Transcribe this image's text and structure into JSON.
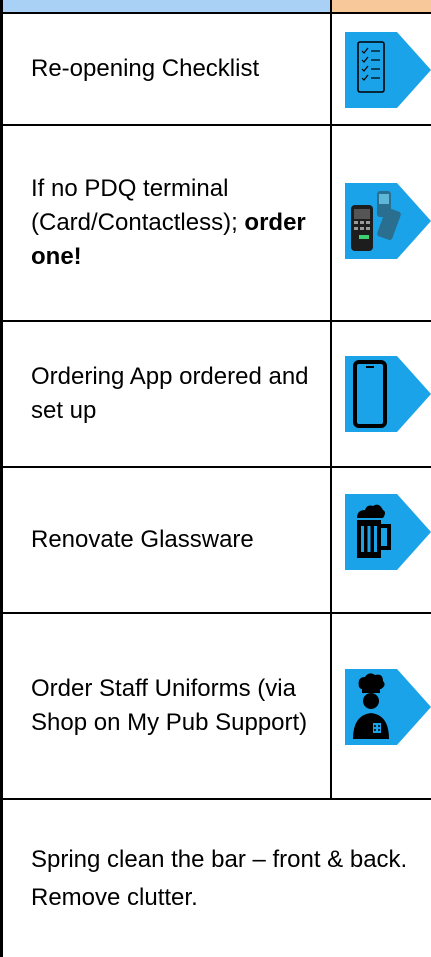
{
  "checklist": {
    "rows": [
      {
        "label": "Re-opening Checklist",
        "icon": "checklist-icon"
      },
      {
        "label_line1": "If no PDQ terminal (Card/Contactless);",
        "label_bold": "order one!",
        "icon": "card-terminal-icon"
      },
      {
        "label": "Ordering App ordered and set up",
        "icon": "smartphone-icon"
      },
      {
        "label": "Renovate Glassware",
        "icon": "beer-mug-icon"
      },
      {
        "label": "Order Staff Uniforms (via Shop on My Pub Support)",
        "icon": "chef-icon"
      }
    ],
    "footer_text": "Spring clean the bar – front & back.  Remove clutter."
  },
  "colors": {
    "accent_blue": "#1aa3e8",
    "header_blue": "#a9d0f5",
    "header_orange": "#f6c89a",
    "border": "#000000"
  }
}
